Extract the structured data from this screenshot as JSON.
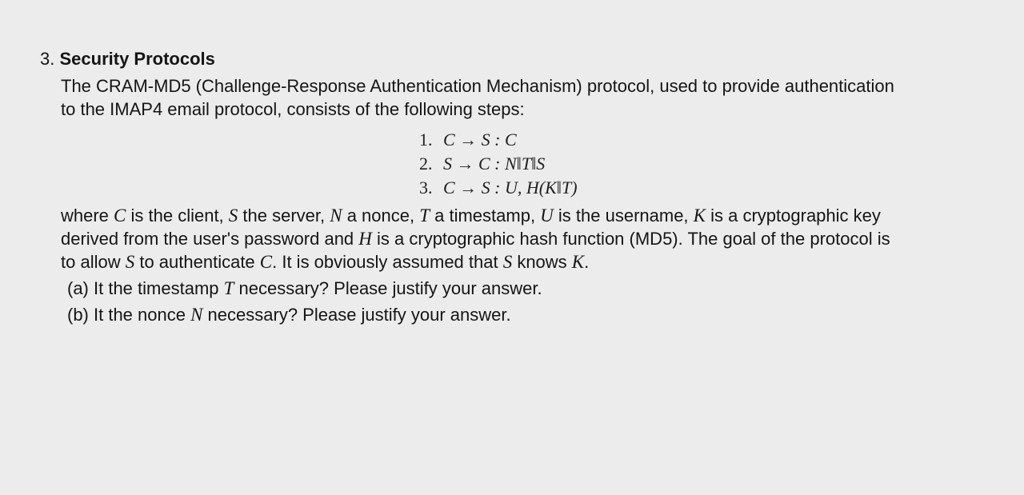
{
  "question": {
    "number": "3.",
    "title": "Security Protocols",
    "intro_line_1": "The CRAM-MD5 (Challenge-Response Authentication Mechanism) protocol, used to provide authentication",
    "intro_line_2": "to the IMAP4 email protocol, consists of the following steps:",
    "steps": [
      {
        "num": "1.",
        "text": "C → S : C"
      },
      {
        "num": "2.",
        "text": "S → C : N‖T‖S"
      },
      {
        "num": "3.",
        "text": "C → S : U, H(K‖T)"
      }
    ],
    "where_line_1": {
      "p1": "where ",
      "m1": "C",
      "p2": " is the client, ",
      "m2": "S",
      "p3": " the server, ",
      "m3": "N",
      "p4": " a nonce, ",
      "m4": "T",
      "p5": " a timestamp, ",
      "m5": "U",
      "p6": " is the username, ",
      "m6": "K",
      "p7": " is a cryptographic key"
    },
    "where_line_2": {
      "p1": "derived from the user's password and ",
      "m1": "H",
      "p2": " is a cryptographic hash function (MD5).  The goal of the protocol is"
    },
    "where_line_3": {
      "p1": "to allow ",
      "m1": "S",
      "p2": " to authenticate ",
      "m2": "C",
      "p3": ".  It is obviously assumed that ",
      "m3": "S",
      "p4": " knows ",
      "m4": "K",
      "p5": "."
    },
    "sub_a": {
      "p1": "(a) It the timestamp ",
      "m1": "T",
      "p2": " necessary? Please justify your answer."
    },
    "sub_b": {
      "p1": "(b) It the nonce ",
      "m1": "N",
      "p2": " necessary? Please justify your answer."
    }
  }
}
